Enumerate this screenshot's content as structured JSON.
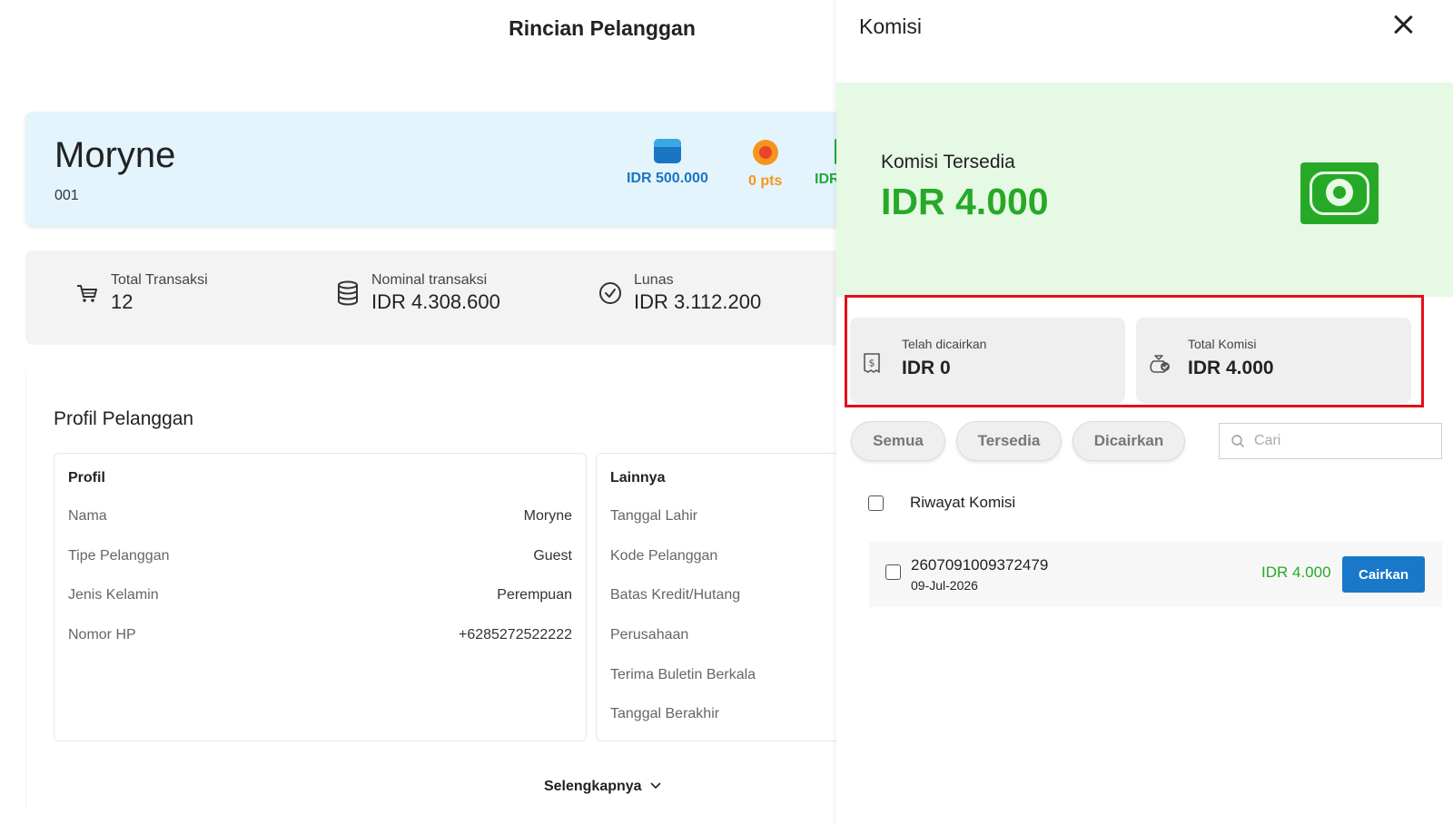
{
  "page": {
    "title": "Rincian Pelanggan"
  },
  "customer": {
    "name": "Moryne",
    "code": "001",
    "balance": "IDR 500.000",
    "points": "0 pts",
    "third_stat": "IDR",
    "colors": {
      "balance": "#1a76c2",
      "points": "#f5951f",
      "third": "#22a93a"
    }
  },
  "summary": [
    {
      "label": "Total Transaksi",
      "value": "12",
      "icon": "cart-icon"
    },
    {
      "label": "Nominal transaksi",
      "value": "IDR 4.308.600",
      "icon": "database-icon"
    },
    {
      "label": "Lunas",
      "value": "IDR 3.112.200",
      "icon": "check-circle-icon"
    }
  ],
  "profile": {
    "section_title": "Profil Pelanggan",
    "profil_heading": "Profil",
    "profil_rows": [
      {
        "key": "Nama",
        "value": "Moryne"
      },
      {
        "key": "Tipe Pelanggan",
        "value": "Guest"
      },
      {
        "key": "Jenis Kelamin",
        "value": "Perempuan"
      },
      {
        "key": "Nomor HP",
        "value": "+6285272522222"
      }
    ],
    "lainnya_heading": "Lainnya",
    "lainnya_rows": [
      {
        "key": "Tanggal Lahir"
      },
      {
        "key": "Kode Pelanggan"
      },
      {
        "key": "Batas Kredit/Hutang"
      },
      {
        "key": "Perusahaan"
      },
      {
        "key": "Terima Buletin Berkala"
      },
      {
        "key": "Tanggal Berakhir"
      }
    ],
    "more_link": "Selengkapnya"
  },
  "drawer": {
    "title": "Komisi",
    "available_label": "Komisi Tersedia",
    "available_value": "IDR 4.000",
    "accent_color": "#27a928",
    "disbursed": {
      "label": "Telah dicairkan",
      "value": "IDR 0",
      "icon": "receipt-dollar-icon"
    },
    "total": {
      "label": "Total Komisi",
      "value": "IDR 4.000",
      "icon": "money-bag-check-icon"
    },
    "filters": [
      "Semua",
      "Tersedia",
      "Dicairkan"
    ],
    "search_placeholder": "Cari",
    "history_label": "Riwayat Komisi",
    "transactions": [
      {
        "id": "2607091009372479",
        "date": "09-Jul-2026",
        "amount": "IDR 4.000",
        "action": "Cairkan"
      }
    ]
  }
}
